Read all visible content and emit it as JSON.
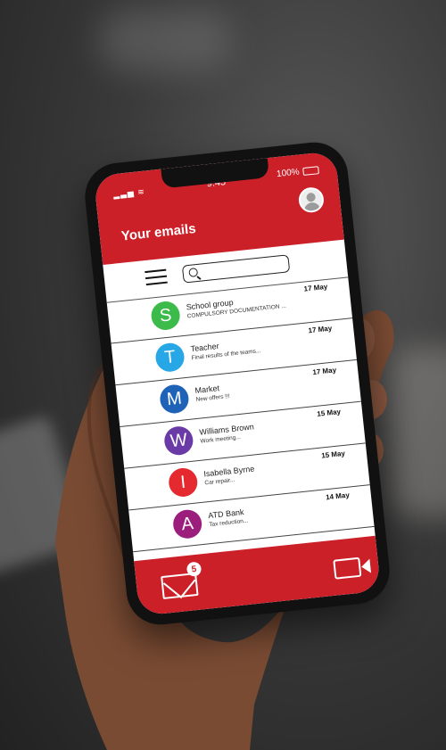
{
  "status": {
    "time": "9:45",
    "battery": "100%"
  },
  "header": {
    "title": "Your emails"
  },
  "search": {
    "placeholder": ""
  },
  "emails": [
    {
      "initial": "S",
      "color": "#3dbb4a",
      "sender": "School group",
      "preview": "COMPULSORY DOCUMENTATION ...",
      "date": "17 May"
    },
    {
      "initial": "T",
      "color": "#27a7e6",
      "sender": "Teacher",
      "preview": "Final results of the teams...",
      "date": "17 May"
    },
    {
      "initial": "M",
      "color": "#1f63b9",
      "sender": "Market",
      "preview": "New offers !!!",
      "date": "17 May"
    },
    {
      "initial": "W",
      "color": "#6a3aa7",
      "sender": "Williams Brown",
      "preview": "Work meeting...",
      "date": "15 May"
    },
    {
      "initial": "I",
      "color": "#e52a2f",
      "sender": "Isabella Byrne",
      "preview": "Car repair...",
      "date": "15 May"
    },
    {
      "initial": "A",
      "color": "#9b1e7c",
      "sender": "ATD Bank",
      "preview": "Tax reduction...",
      "date": "14 May"
    }
  ],
  "bottom": {
    "mail_badge": "5"
  }
}
